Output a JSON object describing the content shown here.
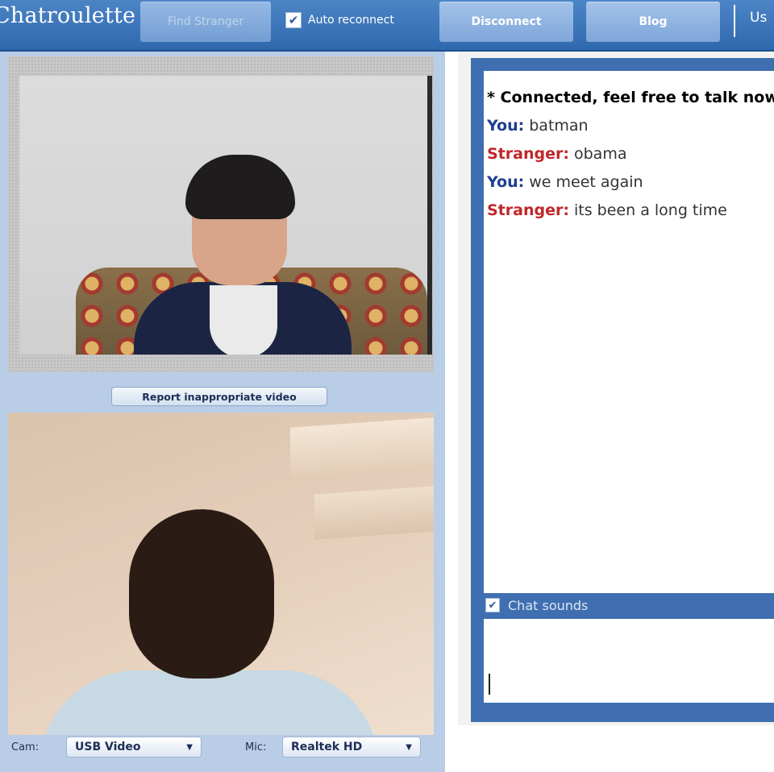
{
  "header": {
    "brand": "Chatroulette",
    "find_stranger": "Find Stranger",
    "auto_reconnect": "Auto reconnect",
    "auto_reconnect_checked": true,
    "disconnect": "Disconnect",
    "blog": "Blog",
    "user_partial": "Us"
  },
  "video": {
    "report_button": "Report inappropriate video"
  },
  "controls": {
    "cam_label": "Cam:",
    "cam_value": "USB Video",
    "mic_label": "Mic:",
    "mic_value": "Realtek HD"
  },
  "chat": {
    "status": "* Connected, feel free to talk now",
    "messages": [
      {
        "who": "You:",
        "text": "batman"
      },
      {
        "who": "Stranger:",
        "text": "obama"
      },
      {
        "who": "You:",
        "text": "we meet again"
      },
      {
        "who": "Stranger:",
        "text": "its been a long time"
      }
    ],
    "sounds_label": "Chat sounds",
    "sounds_checked": true
  },
  "colors": {
    "brand_blue": "#2f68ad",
    "you_color": "#1d3f8f",
    "stranger_color": "#c0262a"
  }
}
